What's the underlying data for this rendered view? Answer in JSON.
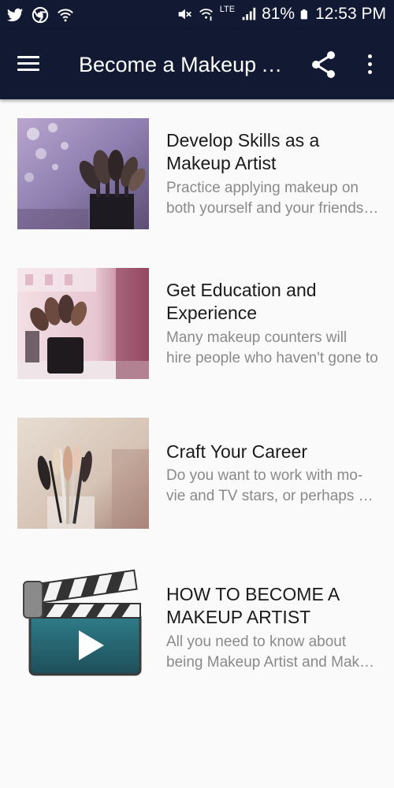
{
  "status_bar": {
    "battery_text": "81%",
    "time": "12:53 PM",
    "network": "LTE",
    "icons": [
      "twitter-icon",
      "chrome-icon",
      "wifi-icon",
      "mute-icon",
      "wifi-calling-icon",
      "lte-icon",
      "signal-icon",
      "battery-icon"
    ]
  },
  "app_bar": {
    "title": "Become a Makeup Artist",
    "icons": [
      "menu-icon",
      "share-icon",
      "more-vert-icon"
    ]
  },
  "colors": {
    "app_bar": "#121a33",
    "background": "#fafafa",
    "title_text": "#1a1a1a",
    "description_text": "#8a8a8a"
  },
  "items": [
    {
      "title_lines": [
        "Develop Skills as a",
        "Makeup Artist"
      ],
      "desc_lines": [
        "Practice applying makeup on",
        "both yourself and your friends to"
      ],
      "thumb": "brushes-purple-bokeh"
    },
    {
      "title_lines": [
        "Get Education and",
        "Experience"
      ],
      "desc_lines": [
        "Many makeup counters will",
        "hire people who haven't gone to"
      ],
      "thumb": "brushes-cup-pink"
    },
    {
      "title_lines": [
        "Craft Your Career"
      ],
      "desc_lines": [
        "Do you want to work with mo-",
        "vie and TV stars, or perhaps you"
      ],
      "thumb": "brushes-glass-beige"
    },
    {
      "title_lines": [
        "HOW TO BECOME A",
        "MAKEUP ARTIST"
      ],
      "desc_lines": [
        "All you need to know about",
        "being Makeup Artist and Makeup"
      ],
      "thumb": "video-clapperboard-icon"
    }
  ]
}
